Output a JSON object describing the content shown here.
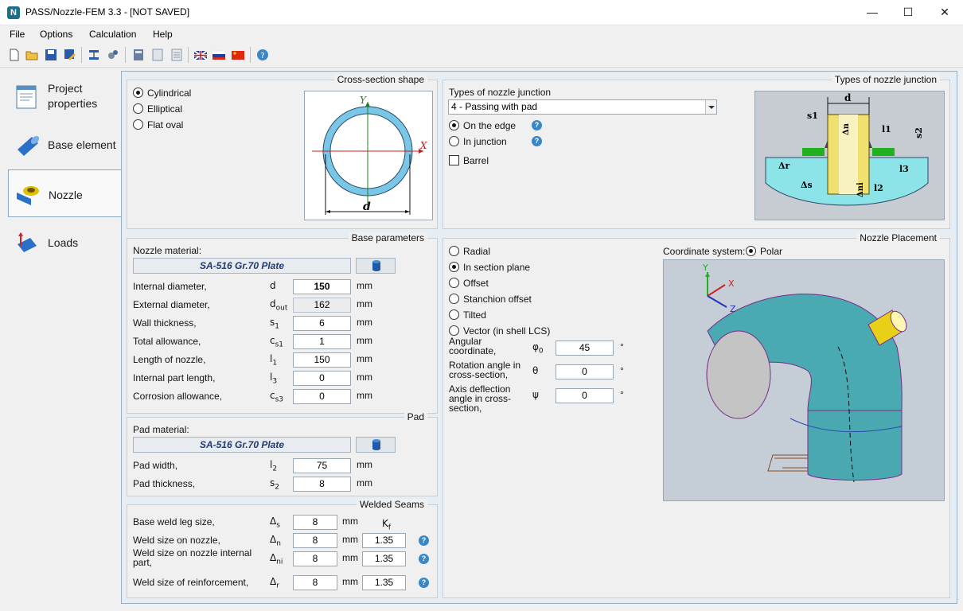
{
  "window": {
    "title": "PASS/Nozzle-FEM 3.3 - [NOT SAVED]",
    "app_icon_letter": "N"
  },
  "menu": [
    "File",
    "Options",
    "Calculation",
    "Help"
  ],
  "nav": [
    {
      "label": "Project\nproperties"
    },
    {
      "label": "Base element"
    },
    {
      "label": "Nozzle"
    },
    {
      "label": "Loads"
    }
  ],
  "cross_section": {
    "title": "Cross-section shape",
    "options": [
      "Cylindrical",
      "Elliptical",
      "Flat oval"
    ],
    "selected": "Cylindrical",
    "axis_y": "Y",
    "axis_x": "X",
    "dim_label": "d"
  },
  "junction": {
    "title": "Types of nozzle junction",
    "label": "Types of nozzle junction",
    "value": "4 - Passing with pad",
    "options": [
      "On the edge",
      "In junction"
    ],
    "selected": "On the edge",
    "barrel_label": "Barrel",
    "barrel_checked": false,
    "diagram": {
      "d": "d",
      "s1": "s1",
      "dn": "Δn",
      "l1": "l1",
      "s2": "s2",
      "dr": "Δr",
      "l3": "l3",
      "ds": "Δs",
      "dni": "Δni",
      "l2": "l2"
    }
  },
  "base_params": {
    "title": "Base parameters",
    "material_label": "Nozzle material:",
    "material": "SA-516 Gr.70 Plate",
    "rows": [
      {
        "label": "Internal diameter,",
        "sym": "d",
        "sub": "",
        "value": "150",
        "unit": "mm",
        "bold": true,
        "ro": false
      },
      {
        "label": "External diameter,",
        "sym": "d",
        "sub": "out",
        "value": "162",
        "unit": "mm",
        "bold": false,
        "ro": true
      },
      {
        "label": "Wall thickness,",
        "sym": "s",
        "sub": "1",
        "value": "6",
        "unit": "mm",
        "bold": false,
        "ro": false
      },
      {
        "label": "Total allowance,",
        "sym": "c",
        "sub": "s1",
        "value": "1",
        "unit": "mm",
        "bold": false,
        "ro": false
      },
      {
        "label": "Length of nozzle,",
        "sym": "l",
        "sub": "1",
        "value": "150",
        "unit": "mm",
        "bold": false,
        "ro": false
      },
      {
        "label": "Internal part length,",
        "sym": "l",
        "sub": "3",
        "value": "0",
        "unit": "mm",
        "bold": false,
        "ro": false
      },
      {
        "label": "Corrosion allowance,",
        "sym": "c",
        "sub": "s3",
        "value": "0",
        "unit": "mm",
        "bold": false,
        "ro": false
      }
    ]
  },
  "pad": {
    "title": "Pad",
    "material_label": "Pad material:",
    "material": "SA-516 Gr.70 Plate",
    "rows": [
      {
        "label": "Pad width,",
        "sym": "l",
        "sub": "2",
        "value": "75",
        "unit": "mm"
      },
      {
        "label": "Pad thickness,",
        "sym": "s",
        "sub": "2",
        "value": "8",
        "unit": "mm"
      }
    ]
  },
  "welds": {
    "title": "Welded Seams",
    "kf_label": "K",
    "kf_sub": "f",
    "rows": [
      {
        "label": "Base weld leg size,",
        "sym": "Δ",
        "sub": "s",
        "value": "8",
        "unit": "mm",
        "kf": ""
      },
      {
        "label": "Weld size on nozzle,",
        "sym": "Δ",
        "sub": "n",
        "value": "8",
        "unit": "mm",
        "kf": "1.35"
      },
      {
        "label": "Weld size on nozzle internal\npart,",
        "sym": "Δ",
        "sub": "ni",
        "value": "8",
        "unit": "mm",
        "kf": "1.35"
      },
      {
        "label": "Weld size of reinforcement,",
        "sym": "Δ",
        "sub": "r",
        "value": "8",
        "unit": "mm",
        "kf": "1.35"
      }
    ]
  },
  "placement": {
    "title": "Nozzle Placement",
    "options": [
      "Radial",
      "In section plane",
      "Offset",
      "Stanchion offset",
      "Tilted",
      "Vector (in shell LCS)"
    ],
    "selected": "In section plane",
    "coord_label": "Coordinate system:",
    "coord_value": "Polar",
    "rows": [
      {
        "label": "Angular\ncoordinate,",
        "sym": "φ",
        "sub": "0",
        "value": "45",
        "unit": "°"
      },
      {
        "label": "Rotation angle in\ncross-section,",
        "sym": "θ",
        "sub": "",
        "value": "0",
        "unit": "°"
      },
      {
        "label": "Axis deflection\nangle in cross-\nsection,",
        "sym": "ψ",
        "sub": "",
        "value": "0",
        "unit": "°"
      }
    ],
    "axes": {
      "y": "Y",
      "x": "X",
      "z": "Z"
    }
  }
}
